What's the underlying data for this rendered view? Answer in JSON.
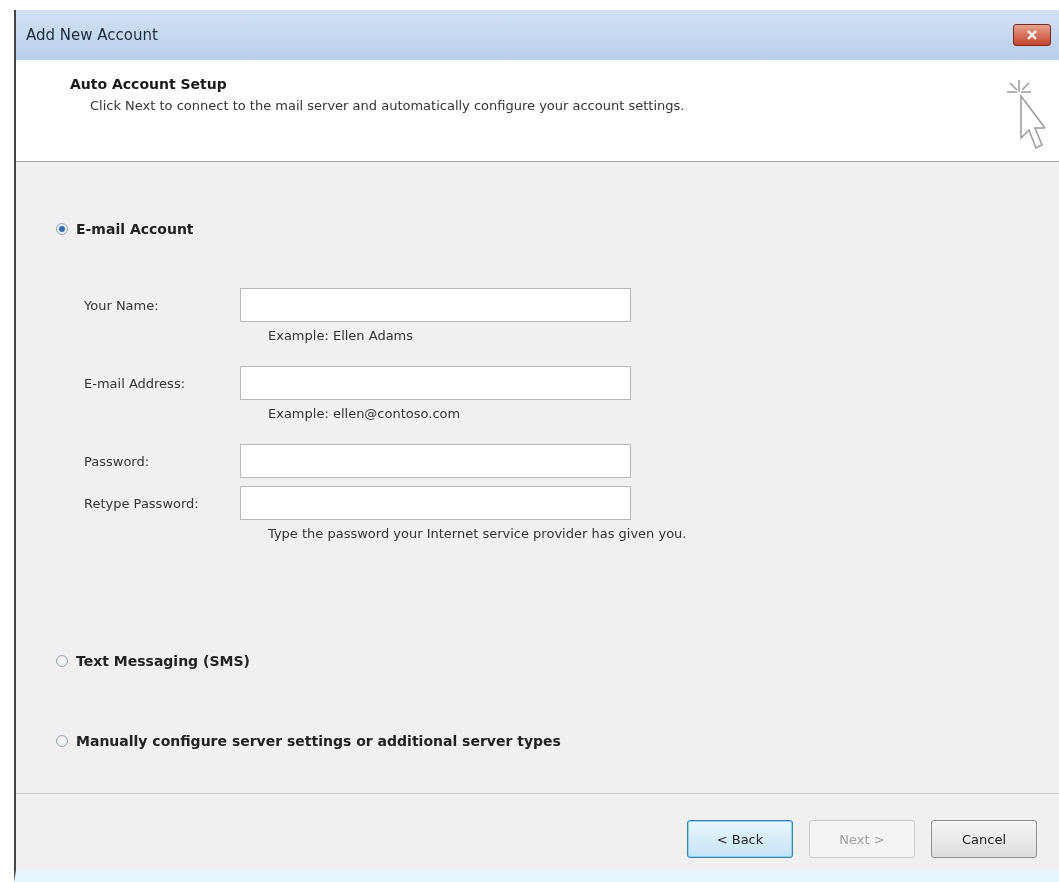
{
  "window": {
    "title": "Add New Account"
  },
  "header": {
    "title": "Auto Account Setup",
    "subtitle": "Click Next to connect to the mail server and automatically configure your account settings."
  },
  "options": [
    {
      "label": "E-mail Account",
      "selected": true,
      "fields": [
        {
          "label": "Your Name:",
          "hint": "Example: Ellen Adams"
        },
        {
          "label": "E-mail Address:",
          "hint": "Example: ellen@contoso.com"
        },
        {
          "label": "Password:"
        },
        {
          "label": "Retype Password:",
          "hint": "Type the password your Internet service provider has given you."
        }
      ]
    },
    {
      "label": "Text Messaging (SMS)",
      "selected": false
    },
    {
      "label": "Manually configure server settings or additional server types",
      "selected": false
    }
  ],
  "buttons": [
    {
      "label": "< Back",
      "disabled": false,
      "default": true
    },
    {
      "label": "Next >",
      "disabled": true,
      "default": false
    },
    {
      "label": "Cancel",
      "disabled": false,
      "default": false
    }
  ]
}
